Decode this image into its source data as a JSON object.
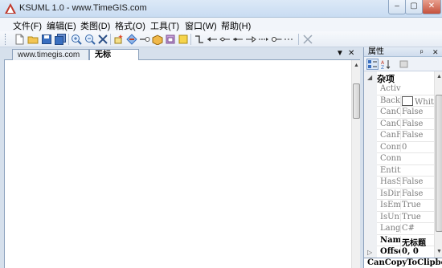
{
  "window": {
    "title": "KSUML 1.0 - www.TimeGIS.com",
    "buttons": {
      "minimize": "–",
      "maximize": "▢",
      "close": "✕"
    }
  },
  "menu": [
    {
      "label": "文件(F)"
    },
    {
      "label": "编辑(E)"
    },
    {
      "label": "类图(D)"
    },
    {
      "label": "格式(O)"
    },
    {
      "label": "工具(T)"
    },
    {
      "label": "窗口(W)"
    },
    {
      "label": "帮助(H)"
    }
  ],
  "toolbar": {
    "icons": [
      "new-file-icon",
      "open-folder-icon",
      "save-icon",
      "save-all-icon",
      "zoom-in-icon",
      "zoom-out-icon",
      "fit-to-window-icon",
      "add-class-icon",
      "add-interface-icon",
      "add-comment-icon",
      "add-package-icon",
      "add-enum-icon",
      "add-note-icon",
      "connector-elbow-icon",
      "association-icon",
      "composition-icon",
      "aggregation-icon",
      "generalization-icon",
      "realization-icon",
      "nesting-icon",
      "dependency-icon",
      "delete-icon"
    ]
  },
  "document": {
    "tabs": [
      {
        "label": "www.timegis.com",
        "active": false
      },
      {
        "label": "无标题.ncp",
        "active": true
      }
    ],
    "tab_controls": {
      "menu": "▼",
      "close": "✕"
    }
  },
  "properties": {
    "title": "属性",
    "controls": {
      "pin": "ᵖ",
      "close": "✕"
    },
    "category": "杂项",
    "category_marker": "◢",
    "rows": [
      {
        "name": "ActiveProject",
        "value": "",
        "bold": false
      },
      {
        "name": "BackColor",
        "value": "White",
        "bold": false,
        "swatch": "#ffffff"
      },
      {
        "name": "CanCopy",
        "value": "False",
        "bold": false
      },
      {
        "name": "CanCut",
        "value": "False",
        "bold": false
      },
      {
        "name": "CanFormat",
        "value": "False",
        "bold": false
      },
      {
        "name": "ConnectionCount",
        "value": "0",
        "bold": false
      },
      {
        "name": "Connections",
        "value": "",
        "bold": false
      },
      {
        "name": "Entities",
        "value": "",
        "bold": false
      },
      {
        "name": "HasSelection",
        "value": "False",
        "bold": false
      },
      {
        "name": "IsDirty",
        "value": "False",
        "bold": false
      },
      {
        "name": "IsEmpty",
        "value": "True",
        "bold": false
      },
      {
        "name": "IsUntitled",
        "value": "True",
        "bold": false
      },
      {
        "name": "Language",
        "value": "C#",
        "bold": false
      },
      {
        "name": "Name",
        "value": "无标题",
        "bold": true
      },
      {
        "name": "Offset",
        "value": "0, 0",
        "bold": true,
        "expandable": true
      }
    ],
    "description": "CanCopyToClipboard"
  },
  "colors": {
    "titlebar": "#dce9f7",
    "menubar": "#f2f5fa",
    "workspace": "#d6e0ec",
    "canvas": "#ffffff",
    "close_button": "#c5513c"
  }
}
